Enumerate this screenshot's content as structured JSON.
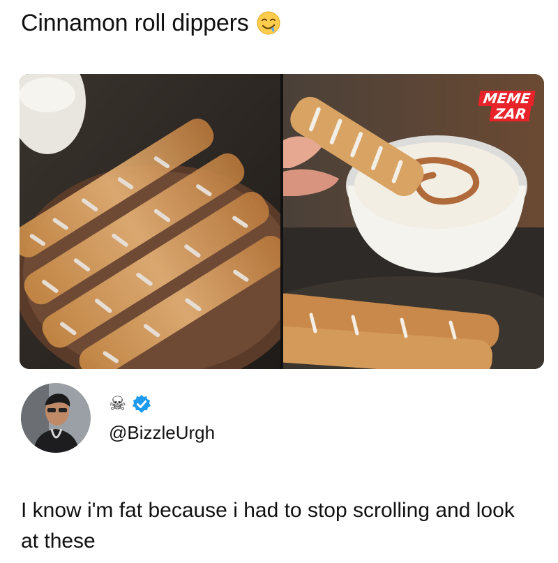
{
  "post": {
    "title": "Cinnamon roll dippers",
    "title_emoji": "drooling-face-emoji",
    "watermark": {
      "line1": "MEME",
      "line2": "ZAR",
      "color": "#e8232a"
    },
    "author": {
      "emoji": "☠",
      "verified_color": "#1d9bf0",
      "handle": "@BizzleUrgh"
    },
    "caption": "I know i'm fat because i had to stop scrolling and look at these"
  }
}
